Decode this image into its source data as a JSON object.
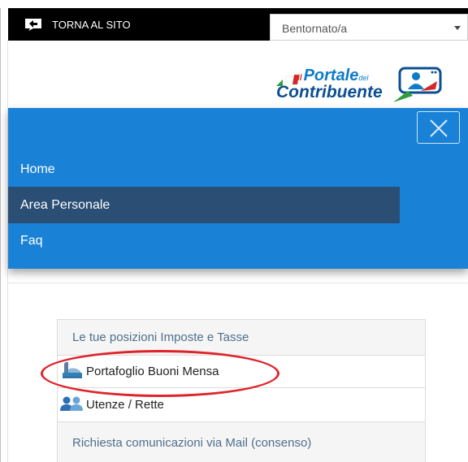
{
  "topbar": {
    "back_label": "TORNA AL SITO",
    "user_select_value": "Bentornato/a"
  },
  "logo": {
    "line1_prefix": "il",
    "line1_main": "Portale",
    "line1_suffix": "del",
    "line2": "Contribuente"
  },
  "nav": {
    "items": [
      {
        "label": "Home"
      },
      {
        "label": "Area Personale"
      },
      {
        "label": "Faq"
      }
    ]
  },
  "panel": {
    "header": "Le tue posizioni Imposte e Tasse",
    "items": [
      {
        "label": "Portafoglio Buoni Mensa",
        "icon": "meal-voucher-icon"
      },
      {
        "label": "Utenze / Rette",
        "icon": "users-icon"
      },
      {
        "label": "Richiesta comunicazioni via Mail (consenso)"
      }
    ]
  },
  "colors": {
    "nav_bg": "#1a82d6",
    "nav_active_bg": "#2a4e74",
    "annotation": "#e0232b"
  }
}
